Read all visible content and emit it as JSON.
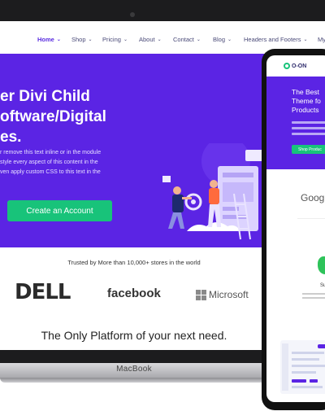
{
  "laptop": {
    "brand": "MacBook",
    "nav": {
      "items": [
        {
          "label": "Home",
          "chevron": true,
          "active": true
        },
        {
          "label": "Shop",
          "chevron": true
        },
        {
          "label": "Pricing",
          "chevron": true
        },
        {
          "label": "About",
          "chevron": true
        },
        {
          "label": "Contact",
          "chevron": true
        },
        {
          "label": "Blog",
          "chevron": true
        },
        {
          "label": "Headers and Footers",
          "chevron": true
        },
        {
          "label": "My",
          "chevron": false
        }
      ]
    },
    "hero": {
      "title_lines": [
        "er Divi Child",
        "oftware/Digital",
        "es."
      ],
      "body_lines": [
        "r remove this text inline or in the module",
        "style every aspect of this content in the",
        "ven apply custom CSS to this text in the"
      ],
      "cta_label": "Create an Account"
    },
    "trusted_text": "Trusted by More than 10,000+ stores in the world",
    "logos": {
      "dell": "DELL",
      "facebook": "facebook",
      "microsoft": "Microsoft"
    },
    "platform_heading": "The Only Platform of your next need."
  },
  "phone": {
    "logo": "O-ON",
    "hero_title_lines": [
      "The Best",
      "Theme fo",
      "Products"
    ],
    "hero_button": "Shop Produc",
    "google_text": "Goog",
    "badge_text": "Su"
  },
  "colors": {
    "accent": "#5b24e4",
    "cta": "#18c37a",
    "nav_text": "#4a4a78",
    "nav_active": "#5a2de0"
  }
}
